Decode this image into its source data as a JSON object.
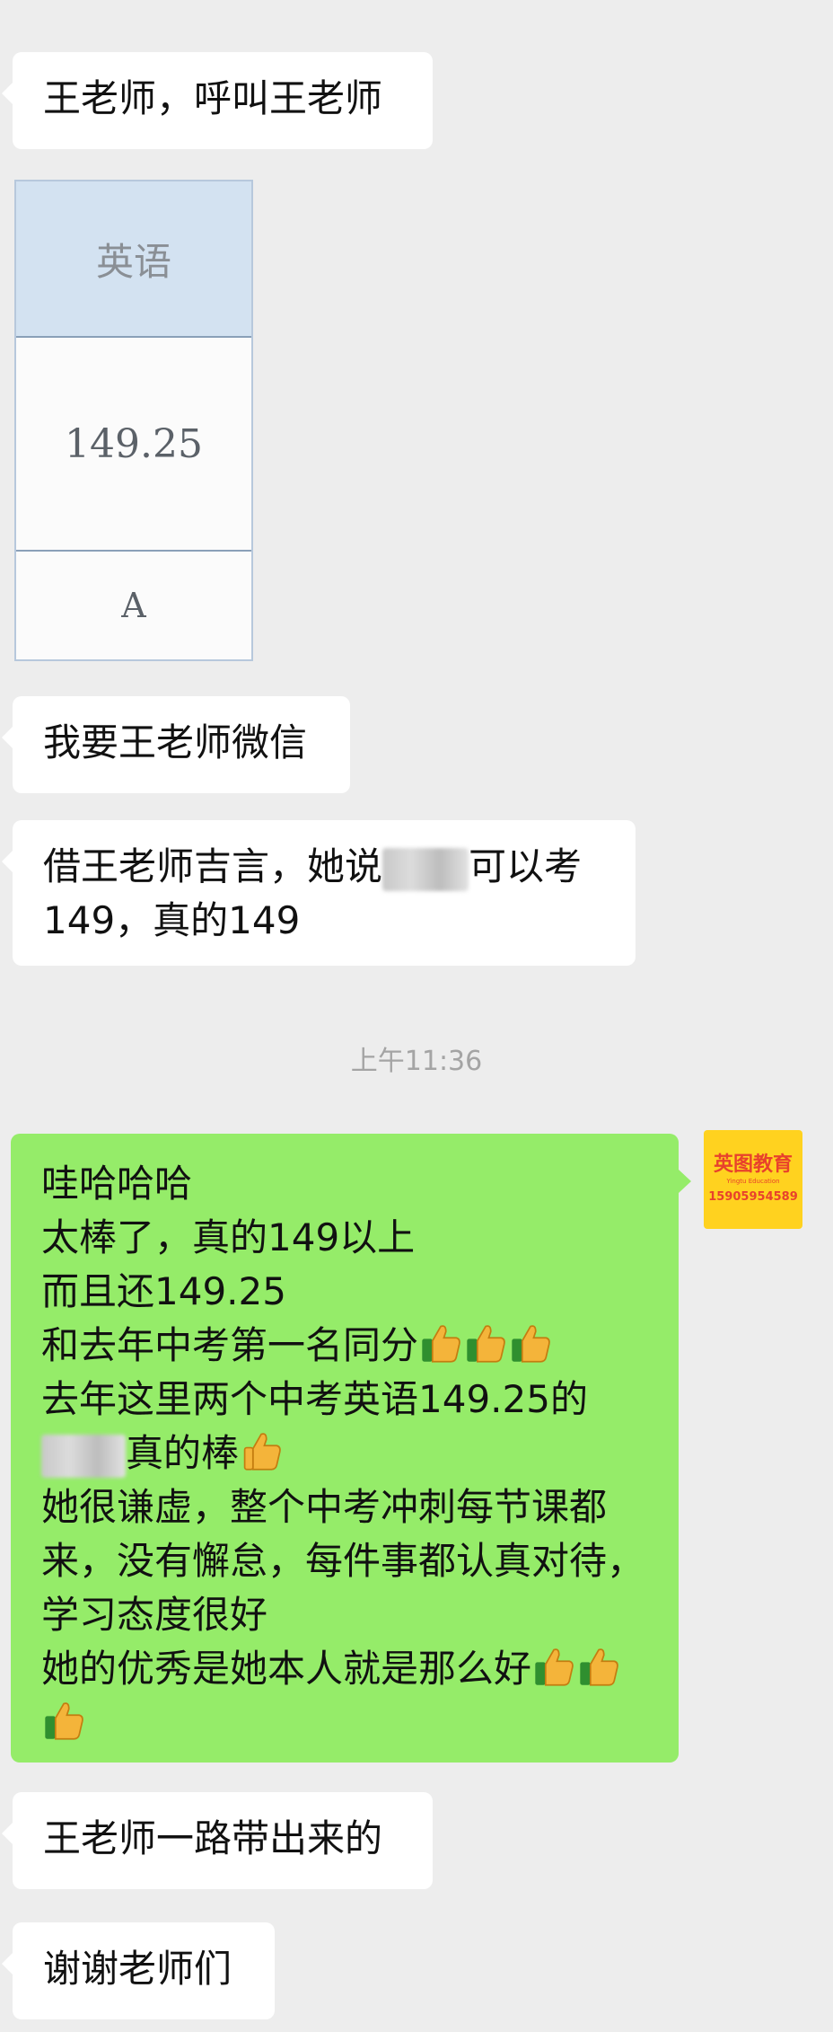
{
  "messages": {
    "m1": "王老师，呼叫王老师",
    "m3": "我要王老师微信",
    "m4_part1": "借王老师吉言，她说",
    "m4_part2": "可以考",
    "m4_line2": "149，真的149",
    "timestamp": "上午11:36",
    "reply": {
      "l1": "哇哈哈哈",
      "l2": "太棒了，真的149以上",
      "l3": "而且还149.25",
      "l4": "和去年中考第一名同分",
      "l5": "去年这里两个中考英语149.25的",
      "l6": "真的棒",
      "l7": "她很谦虚，整个中考冲刺每节课都",
      "l8": "来，没有懈怠，每件事都认真对待，",
      "l9": "学习态度很好",
      "l10": "她的优秀是她本人就是那么好"
    },
    "m6": "王老师一路带出来的",
    "m7": "谢谢老师们"
  },
  "score_card": {
    "subject": "英语",
    "score": "149.25",
    "grade": "A"
  },
  "avatar": {
    "brand": "英图教育",
    "sub": "Yingtu Education",
    "phone": "15905954589"
  },
  "colors": {
    "background": "#ededed",
    "bubble_incoming": "#ffffff",
    "bubble_outgoing": "#95ec69",
    "avatar_bg": "#ffd21f",
    "avatar_text": "#e8412c"
  },
  "icons": {
    "reaction": "thumbs-up-icon"
  }
}
